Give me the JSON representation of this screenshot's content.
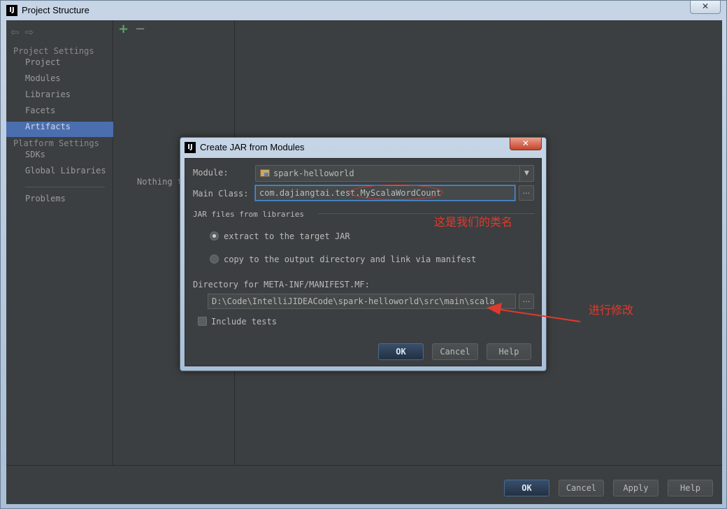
{
  "window": {
    "title": "Project Structure",
    "icon_label": "IJ",
    "close_glyph": "✕"
  },
  "sidebar": {
    "back_icon": "⇦",
    "forward_icon": "⇨",
    "project_settings_heading": "Project Settings",
    "items": [
      {
        "label": "Project"
      },
      {
        "label": "Modules"
      },
      {
        "label": "Libraries"
      },
      {
        "label": "Facets"
      },
      {
        "label": "Artifacts"
      }
    ],
    "platform_settings_heading": "Platform Settings",
    "platform_items": [
      {
        "label": "SDKs"
      },
      {
        "label": "Global Libraries"
      }
    ],
    "problems_label": "Problems",
    "selected": "Artifacts"
  },
  "middle": {
    "add_glyph": "+",
    "remove_glyph": "−",
    "empty_text": "Nothing t"
  },
  "footer": {
    "ok_label": "OK",
    "cancel_label": "Cancel",
    "apply_label": "Apply",
    "help_label": "Help"
  },
  "dialog": {
    "title": "Create JAR from Modules",
    "icon_label": "IJ",
    "close_glyph": "✕",
    "module_label": "Module:",
    "module_value": "spark-helloworld",
    "combo_arrow": "▼",
    "main_class_label": "Main Class:",
    "main_class_value": "com.dajiangtai.test.MyScalaWordCount",
    "browse_glyph": "...",
    "jar_group_label": "JAR files from libraries",
    "radio_extract_label": "extract to the target JAR",
    "radio_copy_label": "copy to the output directory and link via manifest",
    "selected_radio": "extract",
    "manifest_label": "Directory for META-INF/MANIFEST.MF:",
    "manifest_value": "D:\\Code\\IntelliJIDEACode\\spark-helloworld\\src\\main\\scala",
    "include_tests_label": "Include tests",
    "include_tests_checked": false,
    "ok_label": "OK",
    "cancel_label": "Cancel",
    "help_label": "Help"
  },
  "annotations": {
    "class_note": "这是我们的类名",
    "modify_note": "进行修改",
    "color": "#e03a2c"
  }
}
